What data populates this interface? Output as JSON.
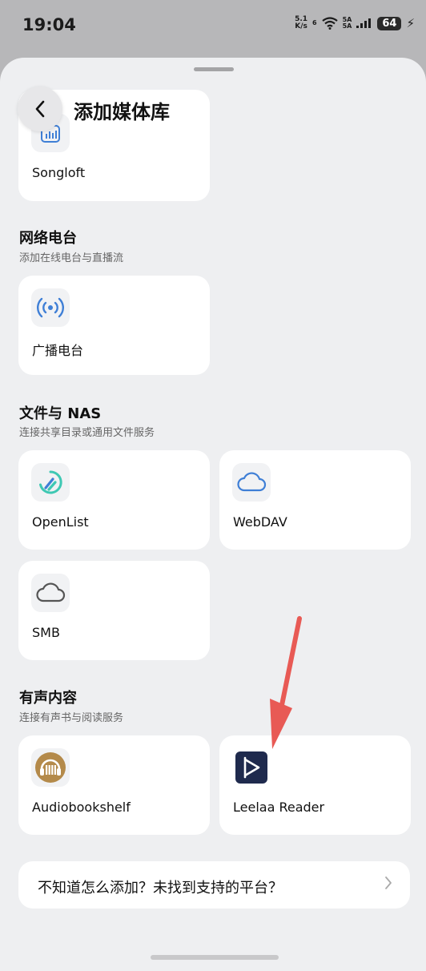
{
  "status_bar": {
    "time": "19:04",
    "net_speed_value": "5.1",
    "net_speed_unit": "K/s",
    "signal_a": "6",
    "signal_b_top": "5A",
    "signal_b_bottom": "5A",
    "battery": "64"
  },
  "header": {
    "title": "添加媒体库"
  },
  "sections": [
    {
      "cards": [
        {
          "label": "Songloft",
          "icon": "songloft-app-icon"
        }
      ]
    },
    {
      "title": "网络电台",
      "subtitle": "添加在线电台与直播流",
      "cards": [
        {
          "label": "广播电台",
          "icon": "radio-broadcast-icon"
        }
      ]
    },
    {
      "title": "文件与 NAS",
      "subtitle": "连接共享目录或通用文件服务",
      "cards": [
        {
          "label": "OpenList",
          "icon": "openlist-app-icon"
        },
        {
          "label": "WebDAV",
          "icon": "cloud-icon"
        },
        {
          "label": "SMB",
          "icon": "cloud-icon"
        }
      ]
    },
    {
      "title": "有声内容",
      "subtitle": "连接有声书与阅读服务",
      "cards": [
        {
          "label": "Audiobookshelf",
          "icon": "audiobookshelf-app-icon"
        },
        {
          "label": "Leelaa Reader",
          "icon": "leelaa-reader-app-icon"
        }
      ]
    }
  ],
  "help": {
    "text": "不知道怎么添加？未找到支持的平台？"
  },
  "colors": {
    "background": "#eeeff1",
    "card": "#ffffff",
    "accent_blue": "#3f7fd6",
    "annotation_arrow": "#e85a55"
  }
}
